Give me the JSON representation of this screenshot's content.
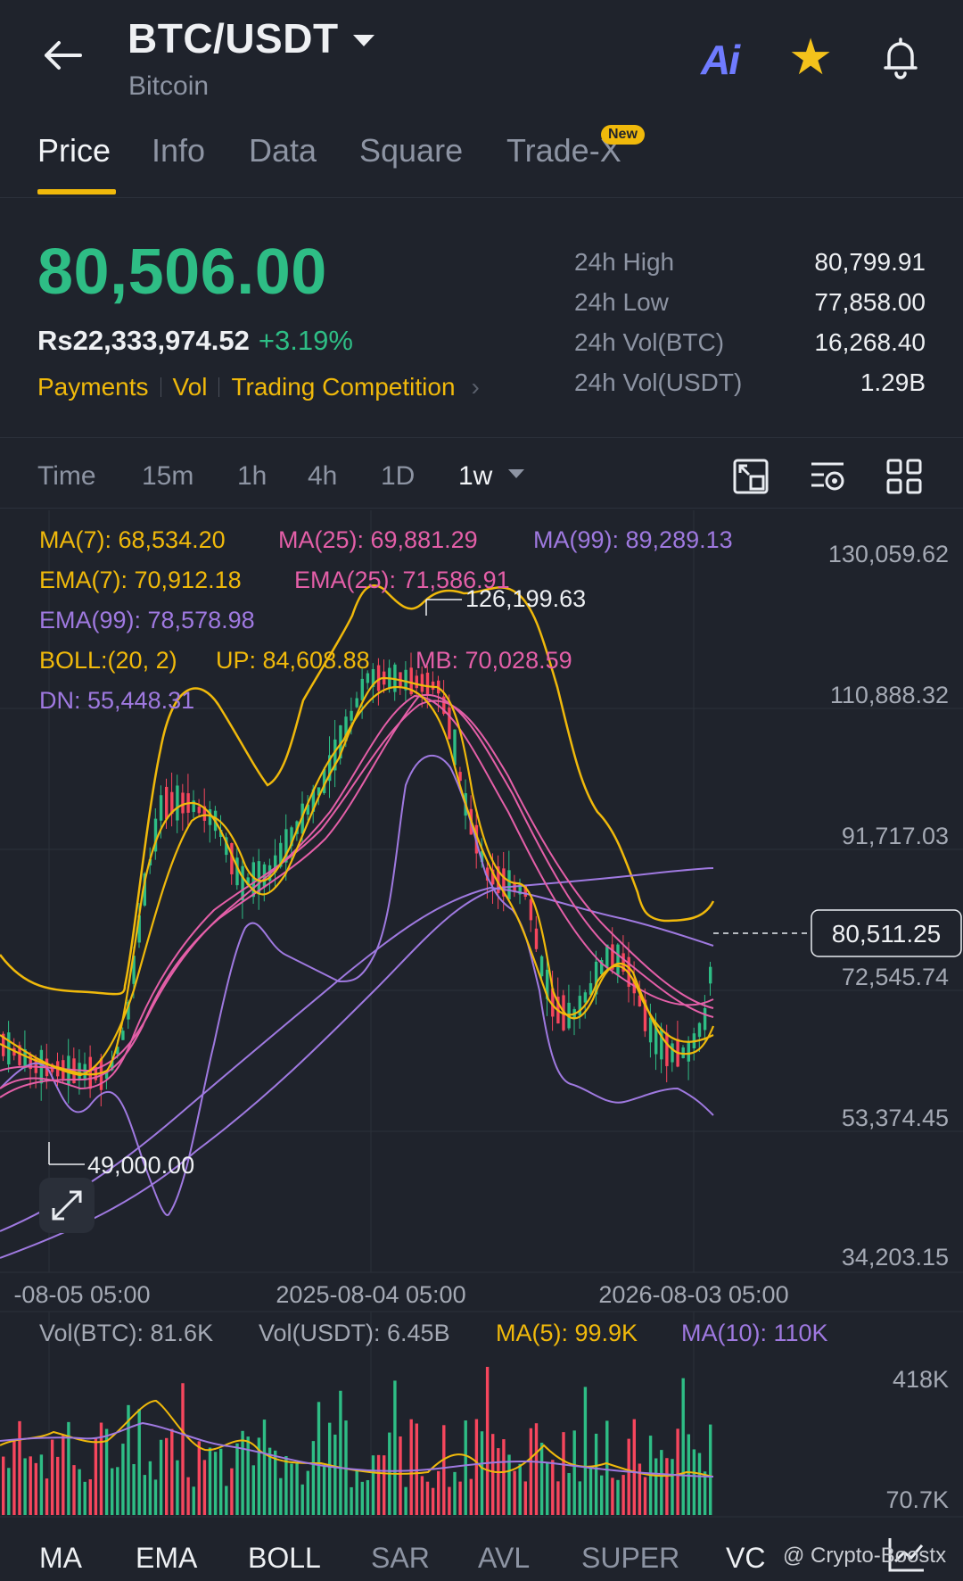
{
  "header": {
    "pair": "BTC/USDT",
    "name": "Bitcoin",
    "ai_label": "Ai"
  },
  "tabs": [
    "Price",
    "Info",
    "Data",
    "Square",
    "Trade-X"
  ],
  "tab_badge": "New",
  "ticker": {
    "last_price": "80,506.00",
    "fiat_price": "Rs22,333,974.52",
    "change_pct": "+3.19%"
  },
  "quick_links": [
    "Payments",
    "Vol",
    "Trading Competition"
  ],
  "stats": [
    {
      "label": "24h High",
      "value": "80,799.91"
    },
    {
      "label": "24h Low",
      "value": "77,858.00"
    },
    {
      "label": "24h Vol(BTC)",
      "value": "16,268.40"
    },
    {
      "label": "24h Vol(USDT)",
      "value": "1.29B"
    }
  ],
  "timeframes": [
    "Time",
    "15m",
    "1h",
    "4h",
    "1D",
    "1w"
  ],
  "active_timeframe": "1w",
  "legend": {
    "ma7": "MA(7): 68,534.20",
    "ma25": "MA(25): 69,881.29",
    "ma99": "MA(99): 89,289.13",
    "ema7": "EMA(7): 70,912.18",
    "ema25": "EMA(25): 71,586.91",
    "ema99": "EMA(99): 78,578.98",
    "boll": "BOLL:(20, 2)",
    "boll_up": "UP: 84,608.88",
    "boll_mb": "MB: 70,028.59",
    "boll_dn": "DN: 55,448.31"
  },
  "price_axis": [
    "130,059.62",
    "110,888.32",
    "91,717.03",
    "72,545.74",
    "53,374.45",
    "34,203.15"
  ],
  "current_price_tag": "80,511.25",
  "high_marker": "126,199.63",
  "low_marker": "49,000.00",
  "date_axis": [
    "-08-05 05:00",
    "2025-08-04 05:00",
    "2026-08-03 05:00"
  ],
  "volume": {
    "vol_btc": "Vol(BTC): 81.6K",
    "vol_usdt": "Vol(USDT): 6.45B",
    "ma5": "MA(5): 99.9K",
    "ma10": "MA(10): 110K",
    "axis_top": "418K",
    "axis_bottom": "70.7K"
  },
  "indicators": [
    "MA",
    "EMA",
    "BOLL",
    "SAR",
    "AVL",
    "SUPER",
    "VC"
  ],
  "watermark": "@ Crypto-Boostx",
  "colors": {
    "up": "#2ebd85",
    "down": "#f6465d",
    "accent": "#f0b90b",
    "ma_pink": "#e45fa8",
    "ma_purple": "#9f79e0",
    "background": "#1f232c"
  }
}
